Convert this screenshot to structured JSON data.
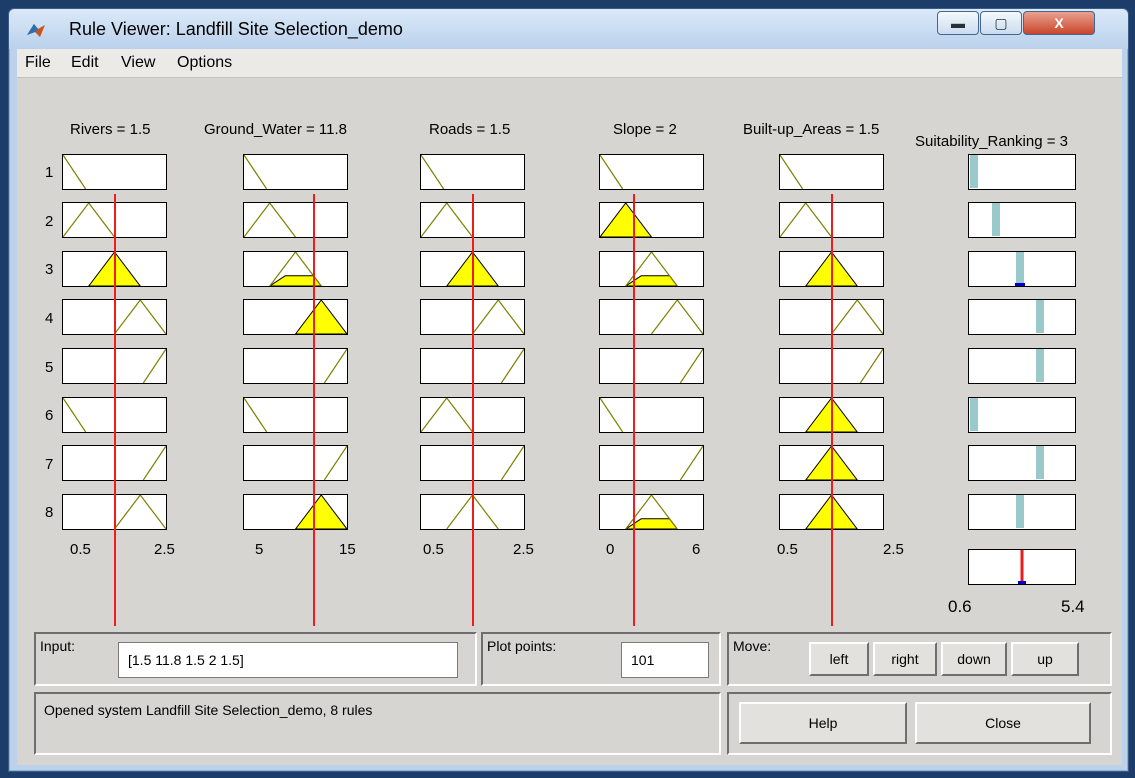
{
  "window": {
    "title": "Rule Viewer: Landfill Site Selection_demo",
    "controls": {
      "minimize": "▬",
      "maximize": "▢",
      "close": "X"
    }
  },
  "menu": [
    "File",
    "Edit",
    "View",
    "Options"
  ],
  "variables": [
    {
      "label": "Rivers = 1.5",
      "range_labels": [
        "0.5",
        "2.5"
      ],
      "value": 1.5
    },
    {
      "label": "Ground_Water = 11.8",
      "range_labels": [
        "5",
        "15"
      ],
      "value": 11.8
    },
    {
      "label": "Roads = 1.5",
      "range_labels": [
        "0.5",
        "2.5"
      ],
      "value": 1.5
    },
    {
      "label": "Slope = 2",
      "range_labels": [
        "0",
        "6"
      ],
      "value": 2
    },
    {
      "label": "Built-up_Areas = 1.5",
      "range_labels": [
        "0.5",
        "2.5"
      ],
      "value": 1.5
    }
  ],
  "output": {
    "label": "Suitability_Ranking = 3",
    "range_labels": [
      "0.6",
      "5.4"
    ],
    "value": 3
  },
  "rules": [
    "1",
    "2",
    "3",
    "4",
    "5",
    "6",
    "7",
    "8"
  ],
  "input": {
    "label": "Input:",
    "value": "[1.5 11.8 1.5 2 1.5]"
  },
  "plot_points": {
    "label": "Plot points:",
    "value": "101"
  },
  "move": {
    "label": "Move:",
    "buttons": [
      "left",
      "right",
      "down",
      "up"
    ]
  },
  "status": "Opened system Landfill Site Selection_demo, 8 rules",
  "help_label": "Help",
  "close_label": "Close",
  "colors": {
    "fill": "#ffff00",
    "line": "#ee1c1c",
    "mf_line": "#7f7f00",
    "output_bar": "#9ac9cc",
    "output_mark": "#0000cc"
  }
}
